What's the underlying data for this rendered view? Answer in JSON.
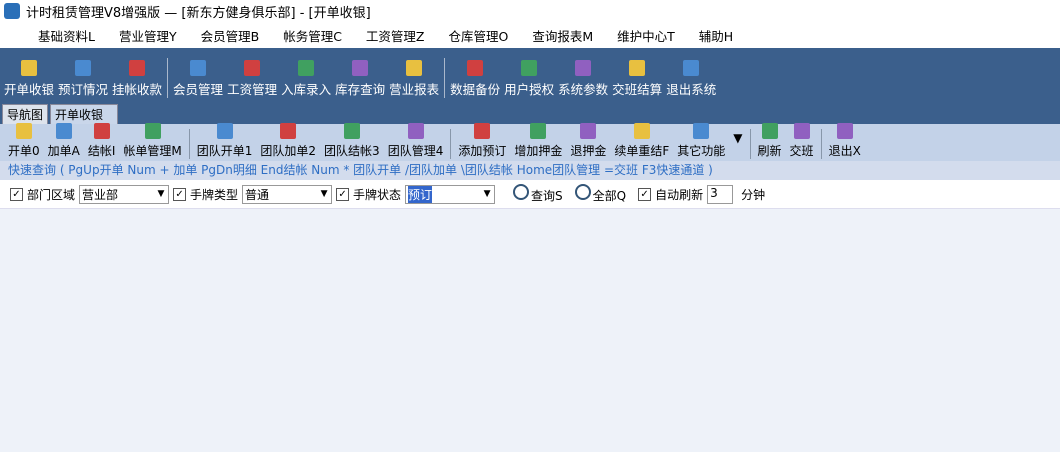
{
  "title": "计时租赁管理V8增强版 — [新东方健身俱乐部]  - [开单收银]",
  "menu": [
    "基础资料L",
    "营业管理Y",
    "会员管理B",
    "帐务管理C",
    "工资管理Z",
    "仓库管理O",
    "查询报表M",
    "维护中心T",
    "辅助H"
  ],
  "toolbar1": [
    [
      "开单收银",
      "预订情况",
      "挂帐收款"
    ],
    [
      "会员管理",
      "工资管理",
      "入库录入",
      "库存查询",
      "营业报表"
    ],
    [
      "数据备份",
      "用户授权",
      "系统参数",
      "交班结算",
      "退出系统"
    ]
  ],
  "tabs": [
    "导航图",
    "开单收银"
  ],
  "toolbar2": [
    [
      "开单0",
      "加单A",
      "结帐I",
      "帐单管理M"
    ],
    [
      "团队开单1",
      "团队加单2",
      "团队结帐3",
      "团队管理4"
    ],
    [
      "添加预订",
      "增加押金",
      "退押金",
      "续单重结F",
      "其它功能",
      "▼"
    ],
    [
      "刷新",
      "交班"
    ],
    [
      "退出X"
    ]
  ],
  "quick": "快速查询 ( PgUp开单   Num + 加单   PgDn明细   End结帐  Num * 团队开单  /团队加单  \\团队结帐  Home团队管理  =交班  F3快速通道 )",
  "filter": {
    "dept_label": "部门区域",
    "dept_value": "营业部",
    "type_label": "手牌类型",
    "type_value": "普通",
    "status_label": "手牌状态",
    "status_value": "预订",
    "query": "查询S",
    "all": "全部Q",
    "auto_label": "自动刷新",
    "auto_value": "3",
    "unit": "分钟"
  }
}
